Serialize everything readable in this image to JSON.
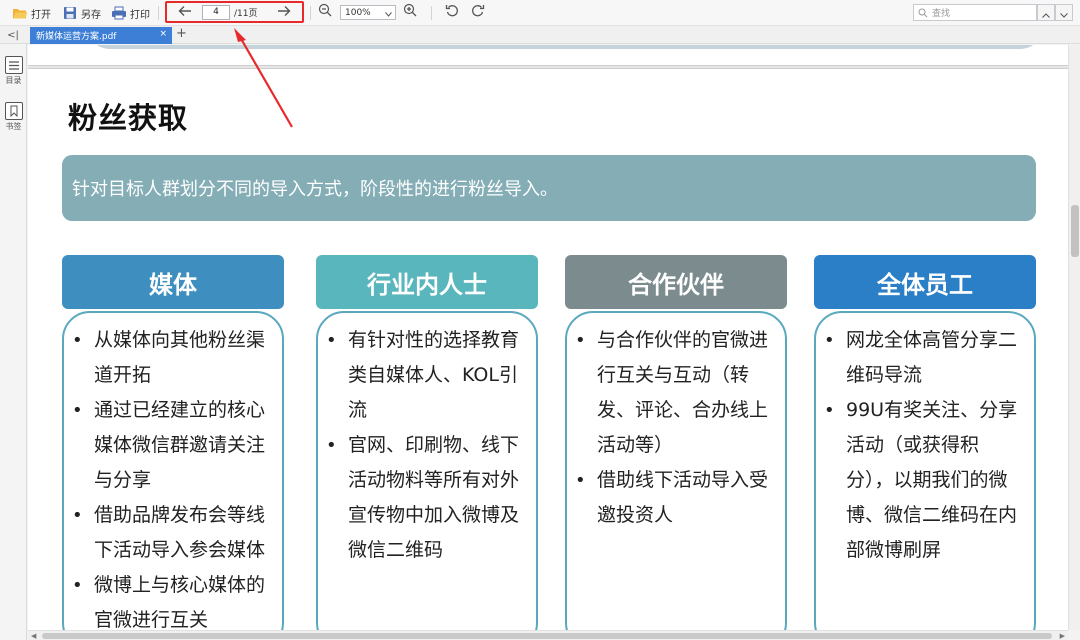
{
  "toolbar": {
    "open_label": "打开",
    "saveas_label": "另存",
    "print_label": "打印",
    "current_page": "4",
    "total_pages": "/11页",
    "zoom_value": "100%",
    "search_placeholder": "查找"
  },
  "tabs": {
    "active_file": "新媒体运营方案.pdf",
    "close_glyph": "×",
    "add_glyph": "+",
    "collapse_glyph": "<|"
  },
  "sidebar": {
    "toc_label": "目录",
    "bookmark_label": "书签"
  },
  "slide": {
    "title": "粉丝获取",
    "banner": "针对目标人群划分不同的导入方式，阶段性的进行粉丝导入。",
    "columns": [
      {
        "heading": "媒体",
        "color": "#3e8fc0",
        "items": [
          "从媒体向其他粉丝渠道开拓",
          "通过已经建立的核心媒体微信群邀请关注与分享",
          "借助品牌发布会等线下活动导入参会媒体",
          "微博上与核心媒体的官微进行互关"
        ]
      },
      {
        "heading": "行业内人士",
        "color": "#5ab6bd",
        "items": [
          "有针对性的选择教育类自媒体人、KOL引流",
          "官网、印刷物、线下活动物料等所有对外宣传物中加入微博及微信二维码"
        ]
      },
      {
        "heading": "合作伙伴",
        "color": "#7b8b8e",
        "items": [
          "与合作伙伴的官微进行互关与互动（转发、评论、合办线上活动等）",
          "借助线下活动导入受邀投资人"
        ]
      },
      {
        "heading": "全体员工",
        "color": "#2b7fc6",
        "items": [
          "网龙全体高管分享二维码导流",
          "99U有奖关注、分享活动（或获得积分），以期我们的微博、微信二维码在内部微博刷屏"
        ]
      }
    ]
  },
  "colors": {
    "highlight_red": "#e8292b",
    "tab_blue": "#3d7fd6",
    "banner_teal": "#84adb6"
  }
}
